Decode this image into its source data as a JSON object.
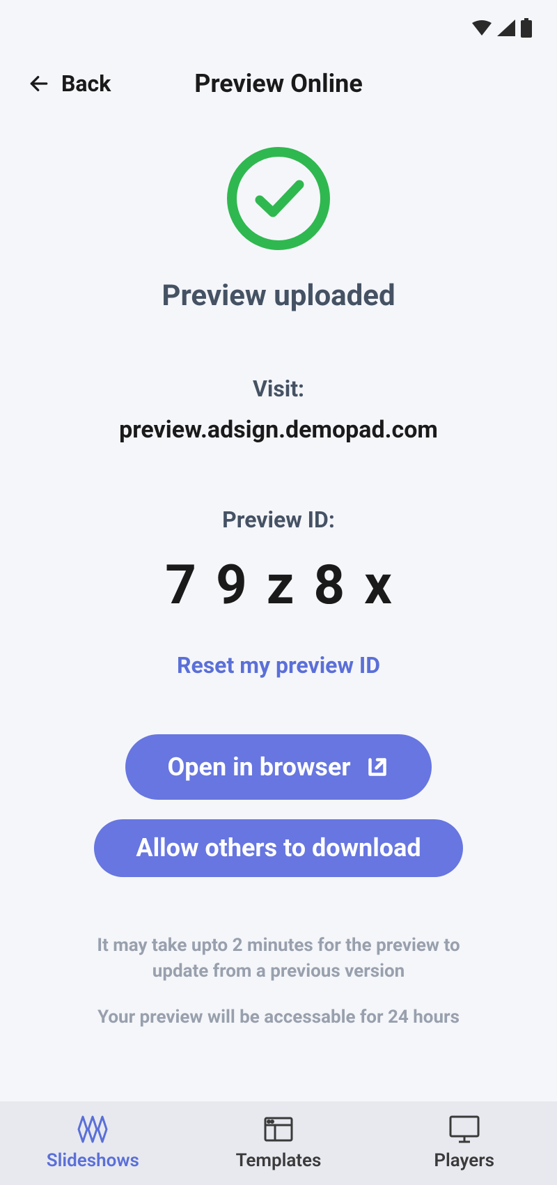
{
  "header": {
    "back_label": "Back",
    "title": "Preview Online"
  },
  "main": {
    "uploaded_title": "Preview uploaded",
    "visit_label": "Visit:",
    "visit_url": "preview.adsign.demopad.com",
    "preview_id_label": "Preview ID:",
    "preview_id_value": "79z8x",
    "reset_link": "Reset my preview ID",
    "open_browser_button": "Open in browser",
    "allow_download_button": "Allow others to download",
    "note1": "It may take upto 2 minutes for the preview to update from a previous version",
    "note2": "Your preview will be accessable for 24 hours"
  },
  "nav": {
    "items": [
      {
        "label": "Slideshows",
        "active": true
      },
      {
        "label": "Templates",
        "active": false
      },
      {
        "label": "Players",
        "active": false
      }
    ]
  },
  "colors": {
    "accent": "#6776e0",
    "success": "#2fb84f",
    "text_primary": "#1a1a1a",
    "text_secondary": "#455264",
    "text_muted": "#98a0ad",
    "background": "#f5f6fa",
    "nav_background": "#e8e9ef"
  }
}
